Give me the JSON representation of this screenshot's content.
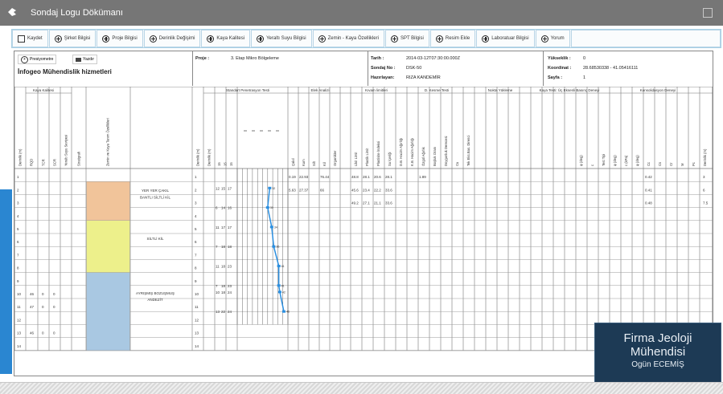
{
  "window": {
    "title": "Sondaj Logu Dökümanı"
  },
  "toolbar": {
    "buttons": [
      {
        "label": "Kaydet",
        "icon": "save-icon"
      },
      {
        "label": "Şirket Bilgisi",
        "icon": "plus-circle-icon"
      },
      {
        "label": "Proje Bilgisi",
        "icon": "plus-circle-icon"
      },
      {
        "label": "Derinlik Değişimi",
        "icon": "plus-circle-icon"
      },
      {
        "label": "Kaya Kalitesi",
        "icon": "plus-circle-icon"
      },
      {
        "label": "Yeraltı Suyu Bilgisi",
        "icon": "plus-circle-icon"
      },
      {
        "label": "Zemin - Kaya Özellikleri",
        "icon": "plus-circle-icon"
      },
      {
        "label": "SPT Bilgisi",
        "icon": "plus-circle-icon"
      },
      {
        "label": "Resim Ekle",
        "icon": "plus-circle-icon"
      },
      {
        "label": "Laboratuar Bilgisi",
        "icon": "plus-circle-icon"
      },
      {
        "label": "Yorum",
        "icon": "plus-circle-icon"
      }
    ]
  },
  "header": {
    "presiyometre_label": "Presiyometre",
    "yazdir_label": "Yazdır",
    "company": "İnfogeo Mühendislik hizmetleri",
    "proje_label": "Proje :",
    "proje_value": "3. Etap Mikro Bölgeleme",
    "tarih_label": "Tarih :",
    "tarih_value": "2014-03-12T07:30:00.000Z",
    "sondaj_label": "Sondaj No :",
    "sondaj_value": "DSK-50",
    "hazirlayan_label": "Hazırlayan:",
    "hazirlayan_value": "RIZA KANDEMİR",
    "yukseklik_label": "Yükseklik :",
    "yukseklik_value": "0",
    "koordinat_label": "Koordinat :",
    "koordinat_value": "28.68530338 - 41.05416111",
    "sayfa_label": "Sayfa :",
    "sayfa_value": "1"
  },
  "table": {
    "group_headers": {
      "kaya_kalitesi": "Kaya Kalitesi",
      "spt": "Standart Penetrasyon Testi",
      "elek": "Elek Analizi",
      "kivam": "Kıvam limitleri",
      "kesme": "D. Kesme Testi",
      "nokta_yukleme": "Nokta Yükleme",
      "kaya_testi": "Kaya Testi: Üç Eksenli Basınç Deneyi",
      "konsolidasyon": "Konsolidasyon Deneyi"
    },
    "columns_left": [
      "Derinlik (m)",
      "RQD",
      "TCR",
      "SCR",
      "Yeraltı Suyu Seviyesi",
      "Stratigrafi",
      "Zemin ve Kaya Tanım Özellikleri",
      "Derinlik (m)",
      "Derinlik (m)"
    ],
    "spt_sub": [
      "15",
      "15",
      "15"
    ],
    "elek_cols": [
      "Çakıl",
      "Kum",
      "Silt",
      "Kil",
      "Organikler"
    ],
    "kivam_cols": [
      "Likit Limit",
      "Plastik Limit",
      "Plastisite İndeksi",
      "Su İçeriği",
      "D.B. Hacim Ağırlığı",
      "K.B. Hacim Ağırlığı"
    ],
    "kesme_cols": [
      "Özgül Ağırlık",
      "Boşluk Oranı",
      "Doygunluk Derecesi",
      "Cu",
      "Tek Eks.Bas. Direnci"
    ],
    "right_cols": [
      "φ (deg)",
      "c",
      "Test Tipi",
      "φ (deg)",
      "c (kPa)",
      "φ (deg)",
      "Cc",
      "Cs",
      "Cr",
      "M",
      "Pc",
      "Derinlik (m)"
    ],
    "rows": [
      "1",
      "2",
      "3",
      "4",
      "5",
      "6",
      "7",
      "8",
      "9",
      "10",
      "11",
      "12",
      "13",
      "14"
    ],
    "rqd_vals": {
      "10": "46",
      "11": "47",
      "13": "46"
    },
    "tcr_vals": {
      "10": "0",
      "11": "0",
      "13": "0"
    },
    "scr_vals": {
      "10": "0",
      "11": "0",
      "13": "0"
    },
    "layer_desc": [
      "YER YER ÇAKIL BANTLI SİLTLİ KİL",
      "SİLTLİ KİL",
      "AYRIŞMIŞ BOZUŞMUŞ ANDEZİT"
    ],
    "layer_colors": [
      "#f1c49a",
      "#edf08b",
      "#a9c8e2"
    ],
    "spt_rows": [
      {
        "d": "1.5",
        "a": "12",
        "b": "15",
        "c": "17",
        "n": "32"
      },
      {
        "d": "3",
        "a": "6",
        "b": "14",
        "c": "16",
        "n": "30"
      },
      {
        "d": "4.5",
        "a": "11",
        "b": "17",
        "c": "17",
        "n": "34"
      },
      {
        "d": "6",
        "a": "7",
        "b": "18",
        "c": "18",
        "n": "36"
      },
      {
        "d": "7.5",
        "a": "11",
        "b": "18",
        "c": "23",
        "n": "41"
      },
      {
        "d": "9",
        "a": "7",
        "b": "18",
        "c": "23",
        "n": "41"
      },
      {
        "d": "9.5",
        "a": "10",
        "b": "18",
        "c": "24",
        "n": "42"
      },
      {
        "d": "11",
        "a": "13",
        "b": "22",
        "c": "24",
        "n": "46"
      }
    ],
    "spt_chart": {
      "type": "line",
      "x": [
        32,
        30,
        34,
        36,
        41,
        41,
        42,
        46
      ],
      "y": [
        1.5,
        3,
        4.5,
        6,
        7.5,
        9,
        9.5,
        11
      ],
      "xlim": [
        0,
        50
      ],
      "ylim": [
        0,
        14
      ]
    },
    "elek_rows": [
      [
        "0.19",
        "22.93",
        "",
        "76.44",
        ""
      ],
      [
        "5.63",
        "27.37",
        "",
        "66",
        ""
      ]
    ],
    "kivam_rows": [
      [
        "48.8",
        "28.1",
        "20.6",
        "28.1",
        "",
        "",
        "1.89"
      ],
      [
        "45.6",
        "23.4",
        "22.2",
        "33.6",
        "",
        "",
        ""
      ],
      [
        "49.2",
        "27.1",
        "21.1",
        "33.6",
        "",
        "",
        ""
      ]
    ],
    "konsol_rows": [
      [
        "0.42",
        "3"
      ],
      [
        "0.41",
        "6"
      ],
      [
        "0.48",
        "7.5"
      ]
    ]
  },
  "logo": {
    "line1": "Firma Jeoloji",
    "line2": "Mühendisi",
    "line3": "Ogün ECEMİŞ"
  },
  "colors": {
    "titlebar": "#767676",
    "toolbar_border": "#a7cfe4",
    "spt_line": "#2b8fe0"
  }
}
